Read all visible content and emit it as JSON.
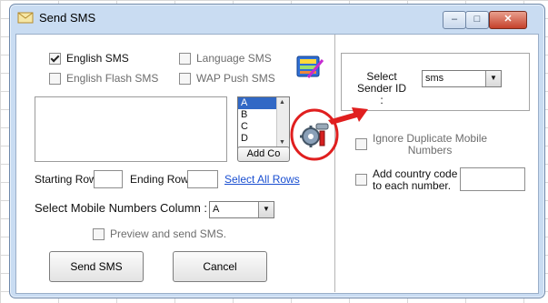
{
  "window": {
    "title": "Send SMS",
    "icon": "envelope-icon",
    "controls": {
      "minimize": "–",
      "maximize": "□",
      "close": "✕"
    }
  },
  "message_types": {
    "english_sms": {
      "label": "English SMS",
      "checked": true
    },
    "language_sms": {
      "label": "Language SMS",
      "checked": false
    },
    "english_flash_sms": {
      "label": "English Flash SMS",
      "checked": false
    },
    "wap_push_sms": {
      "label": "WAP Push SMS",
      "checked": false
    }
  },
  "columns_list": {
    "items": [
      "A",
      "B",
      "C",
      "D"
    ],
    "selected": "A",
    "add_button": "Add Co"
  },
  "rows": {
    "starting_row_label": "Starting Row",
    "ending_row_label": "Ending Row",
    "starting_row_value": "",
    "ending_row_value": "",
    "select_all_link": "Select All Rows"
  },
  "mobile_column": {
    "label": "Select Mobile Numbers Column :",
    "value": "A"
  },
  "preview": {
    "label": "Preview  and  send  SMS.",
    "checked": false
  },
  "buttons": {
    "send": "Send SMS",
    "cancel": "Cancel"
  },
  "sender": {
    "label_line1": "Select",
    "label_line2": "Sender ID :",
    "value": "sms"
  },
  "ignore_duplicates": {
    "label_line1": "Ignore Duplicate Mobile",
    "label_line2": "Numbers",
    "checked": false
  },
  "country_code": {
    "label_line1": "Add country code",
    "label_line2": "to each number.",
    "checked": false,
    "value": ""
  },
  "colors": {
    "annotation": "#e01f1f",
    "link": "#1a4fd1",
    "window_frame": "#c9dcf2"
  }
}
